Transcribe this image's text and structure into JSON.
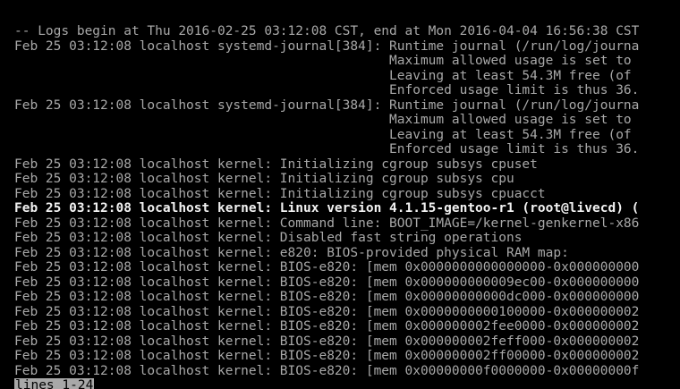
{
  "journal": {
    "header": "-- Logs begin at Thu 2016-02-25 03:12:08 CST, end at Mon 2016-04-04 16:56:38 CST",
    "lines": [
      {
        "text": "Feb 25 03:12:08 localhost systemd-journal[384]: Runtime journal (/run/log/journa",
        "bold": false
      },
      {
        "text": "                                                Maximum allowed usage is set to",
        "bold": false
      },
      {
        "text": "                                                Leaving at least 54.3M free (of",
        "bold": false
      },
      {
        "text": "                                                Enforced usage limit is thus 36.",
        "bold": false
      },
      {
        "text": "Feb 25 03:12:08 localhost systemd-journal[384]: Runtime journal (/run/log/journa",
        "bold": false
      },
      {
        "text": "                                                Maximum allowed usage is set to",
        "bold": false
      },
      {
        "text": "                                                Leaving at least 54.3M free (of",
        "bold": false
      },
      {
        "text": "                                                Enforced usage limit is thus 36.",
        "bold": false
      },
      {
        "text": "Feb 25 03:12:08 localhost kernel: Initializing cgroup subsys cpuset",
        "bold": false
      },
      {
        "text": "Feb 25 03:12:08 localhost kernel: Initializing cgroup subsys cpu",
        "bold": false
      },
      {
        "text": "Feb 25 03:12:08 localhost kernel: Initializing cgroup subsys cpuacct",
        "bold": false
      },
      {
        "text": "Feb 25 03:12:08 localhost kernel: Linux version 4.1.15-gentoo-r1 (root@livecd) (",
        "bold": true
      },
      {
        "text": "Feb 25 03:12:08 localhost kernel: Command line: BOOT_IMAGE=/kernel-genkernel-x86",
        "bold": false
      },
      {
        "text": "Feb 25 03:12:08 localhost kernel: Disabled fast string operations",
        "bold": false
      },
      {
        "text": "Feb 25 03:12:08 localhost kernel: e820: BIOS-provided physical RAM map:",
        "bold": false
      },
      {
        "text": "Feb 25 03:12:08 localhost kernel: BIOS-e820: [mem 0x0000000000000000-0x000000000",
        "bold": false
      },
      {
        "text": "Feb 25 03:12:08 localhost kernel: BIOS-e820: [mem 0x000000000009ec00-0x000000000",
        "bold": false
      },
      {
        "text": "Feb 25 03:12:08 localhost kernel: BIOS-e820: [mem 0x00000000000dc000-0x000000000",
        "bold": false
      },
      {
        "text": "Feb 25 03:12:08 localhost kernel: BIOS-e820: [mem 0x0000000000100000-0x000000002",
        "bold": false
      },
      {
        "text": "Feb 25 03:12:08 localhost kernel: BIOS-e820: [mem 0x000000002fee0000-0x000000002",
        "bold": false
      },
      {
        "text": "Feb 25 03:12:08 localhost kernel: BIOS-e820: [mem 0x000000002feff000-0x000000002",
        "bold": false
      },
      {
        "text": "Feb 25 03:12:08 localhost kernel: BIOS-e820: [mem 0x000000002ff00000-0x000000002",
        "bold": false
      },
      {
        "text": "Feb 25 03:12:08 localhost kernel: BIOS-e820: [mem 0x00000000f0000000-0x00000000f",
        "bold": false
      }
    ]
  },
  "pager": {
    "status": "lines 1-24"
  },
  "colors": {
    "background": "#000000",
    "text": "#a8a8a8",
    "bold_text": "#f2f2f2",
    "status_bg": "#a8a8a8",
    "status_fg": "#000000"
  }
}
